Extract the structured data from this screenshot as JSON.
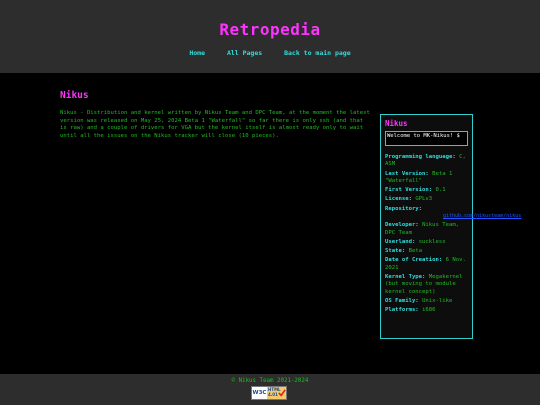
{
  "header": {
    "site_title": "Retropedia",
    "nav": {
      "home": "Home",
      "all_pages": "All Pages",
      "back": "Back to main page"
    }
  },
  "article": {
    "title": "Nikus",
    "text": "Nikus - Distribution and kernel written by Nikus Team and DPC Team, at the moment the latest version was released on May 25, 2024 Beta 1 \"Waterfall\" so far there is only ssh (and that is raw) and a couple of drivers for VGA but the kernel itself is almost ready only to wait until all the issues on the Nikus tracker will close (10 pieces)."
  },
  "infobox": {
    "title": "Nikus",
    "input_value": "Welcome to MK-Nikus! $",
    "rows": [
      {
        "label": "Programming language:",
        "value": "C, ASM"
      },
      {
        "label": "Last Version:",
        "value": "Beta 1 \"Waterfall\""
      },
      {
        "label": "First Version:",
        "value": "0.1"
      },
      {
        "label": "License:",
        "value": "GPLv3"
      },
      {
        "label": "Repository:",
        "value": ""
      },
      {
        "label": "Developer:",
        "value": "Nikus Team, DPC Team"
      },
      {
        "label": "Userland:",
        "value": "suckless"
      },
      {
        "label": "State:",
        "value": "Beta"
      },
      {
        "label": "Date of Creation:",
        "value": "6 Nov. 2021"
      },
      {
        "label": "Kernel Type:",
        "value": "Megakernel (but moving to module kernel concept)"
      },
      {
        "label": "OS Family:",
        "value": "Unix-like"
      },
      {
        "label": "Platforms:",
        "value": "i686"
      }
    ],
    "repository_link": "github.com/nikusteam/nikus"
  },
  "footer": {
    "copyright": "© Nikus Team 2021-2024",
    "badge_w3c": "W3C",
    "badge_html": "HTML",
    "badge_version": "4.01"
  },
  "colors": {
    "background": "#000000",
    "bar": "#2d2d2d",
    "title": "#ff33ff",
    "text": "#22bb22",
    "label": "#33dddd",
    "link": "#2255ff"
  }
}
